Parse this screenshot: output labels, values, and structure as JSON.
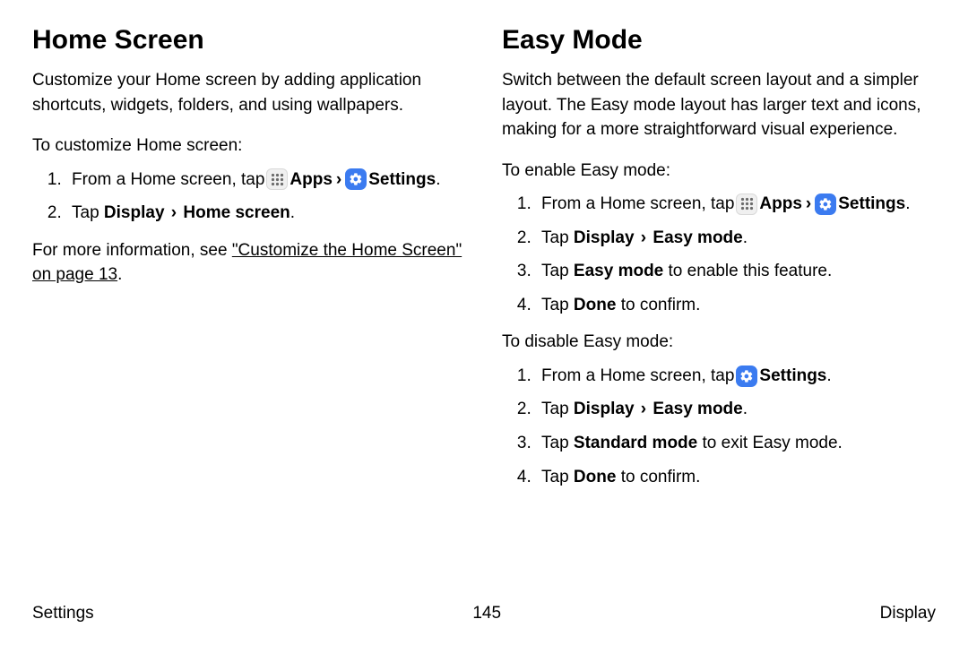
{
  "left": {
    "heading": "Home Screen",
    "intro": "Customize your Home screen by adding application shortcuts, widgets, folders, and using wallpapers.",
    "lead": "To customize Home screen:",
    "step1_a": "From a Home screen, tap",
    "apps_label": "Apps",
    "chevron": "›",
    "settings_label": "Settings",
    "period": ".",
    "step2_a": "Tap ",
    "step2_b": "Display",
    "step2_c": "Home screen",
    "more_a": "For more information, see ",
    "more_link": "\"Customize the Home Screen\" on page 13",
    "more_b": "."
  },
  "right": {
    "heading": "Easy Mode",
    "intro": "Switch between the default screen layout and a simpler layout. The Easy mode layout has larger text and icons, making for a more straightforward visual experience.",
    "lead_enable": "To enable Easy mode:",
    "enable": {
      "s1_a": "From a Home screen, tap",
      "s2_a": "Tap ",
      "s2_b": "Display",
      "s2_c": "Easy mode",
      "s3_a": "Tap ",
      "s3_b": "Easy mode",
      "s3_c": " to enable this feature.",
      "s4_a": "Tap ",
      "s4_b": "Done",
      "s4_c": " to confirm."
    },
    "lead_disable": "To disable Easy mode:",
    "disable": {
      "s1_a": "From a Home screen, tap",
      "s2_a": "Tap ",
      "s2_b": "Display",
      "s2_c": "Easy mode",
      "s3_a": "Tap ",
      "s3_b": "Standard mode",
      "s3_c": " to exit Easy mode.",
      "s4_a": "Tap ",
      "s4_b": "Done",
      "s4_c": " to confirm."
    }
  },
  "footer": {
    "left": "Settings",
    "center": "145",
    "right": "Display"
  },
  "common": {
    "apps_label": "Apps",
    "settings_label": "Settings",
    "chevron": "›",
    "period": "."
  }
}
